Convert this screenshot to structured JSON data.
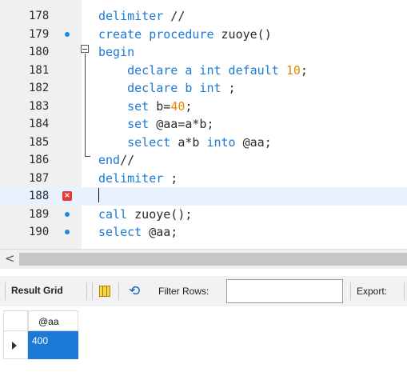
{
  "editor": {
    "lines": [
      {
        "num": "178",
        "marker": "",
        "parts": [
          {
            "t": "delimiter",
            "c": "kw"
          },
          {
            "t": " //",
            "c": "plain"
          }
        ]
      },
      {
        "num": "179",
        "marker": "dot",
        "parts": [
          {
            "t": "create procedure",
            "c": "kw"
          },
          {
            "t": " zuoye()",
            "c": "plain"
          }
        ]
      },
      {
        "num": "180",
        "marker": "",
        "parts": [
          {
            "t": "begin",
            "c": "kw"
          }
        ]
      },
      {
        "num": "181",
        "marker": "",
        "parts": [
          {
            "t": "    declare a int default ",
            "c": "kw"
          },
          {
            "t": "10",
            "c": "num"
          },
          {
            "t": ";",
            "c": "plain"
          }
        ]
      },
      {
        "num": "182",
        "marker": "",
        "parts": [
          {
            "t": "    declare b int",
            "c": "kw"
          },
          {
            "t": " ;",
            "c": "plain"
          }
        ]
      },
      {
        "num": "183",
        "marker": "",
        "parts": [
          {
            "t": "    set",
            "c": "kw"
          },
          {
            "t": " b=",
            "c": "plain"
          },
          {
            "t": "40",
            "c": "num"
          },
          {
            "t": ";",
            "c": "plain"
          }
        ]
      },
      {
        "num": "184",
        "marker": "",
        "parts": [
          {
            "t": "    set",
            "c": "kw"
          },
          {
            "t": " @aa=a*b;",
            "c": "plain"
          }
        ]
      },
      {
        "num": "185",
        "marker": "",
        "parts": [
          {
            "t": "    select",
            "c": "kw"
          },
          {
            "t": " a*b ",
            "c": "plain"
          },
          {
            "t": "into",
            "c": "kw"
          },
          {
            "t": " @aa;",
            "c": "plain"
          }
        ]
      },
      {
        "num": "186",
        "marker": "",
        "parts": [
          {
            "t": "end",
            "c": "kw"
          },
          {
            "t": "//",
            "c": "plain"
          }
        ]
      },
      {
        "num": "187",
        "marker": "",
        "parts": [
          {
            "t": "delimiter",
            "c": "kw"
          },
          {
            "t": " ;",
            "c": "plain"
          }
        ]
      },
      {
        "num": "188",
        "marker": "error",
        "parts": []
      },
      {
        "num": "189",
        "marker": "dot",
        "parts": [
          {
            "t": "call",
            "c": "kw"
          },
          {
            "t": " zuoye();",
            "c": "plain"
          }
        ]
      },
      {
        "num": "190",
        "marker": "dot",
        "parts": [
          {
            "t": "select",
            "c": "kw"
          },
          {
            "t": " @aa;",
            "c": "plain"
          }
        ]
      }
    ]
  },
  "scrollbar": {
    "left_arrow": "<"
  },
  "toolbar": {
    "result_tab": "Result Grid",
    "filter_label": "Filter Rows:",
    "filter_value": "",
    "export_label": "Export:",
    "icons": [
      "grid-icon",
      "refresh-icon"
    ]
  },
  "grid": {
    "columns": [
      "@aa"
    ],
    "rows": [
      [
        "400"
      ]
    ]
  },
  "colors": {
    "keyword": "#1a7ad6",
    "number": "#e08a00",
    "selection": "#1a7ad6",
    "error": "#e53935"
  }
}
